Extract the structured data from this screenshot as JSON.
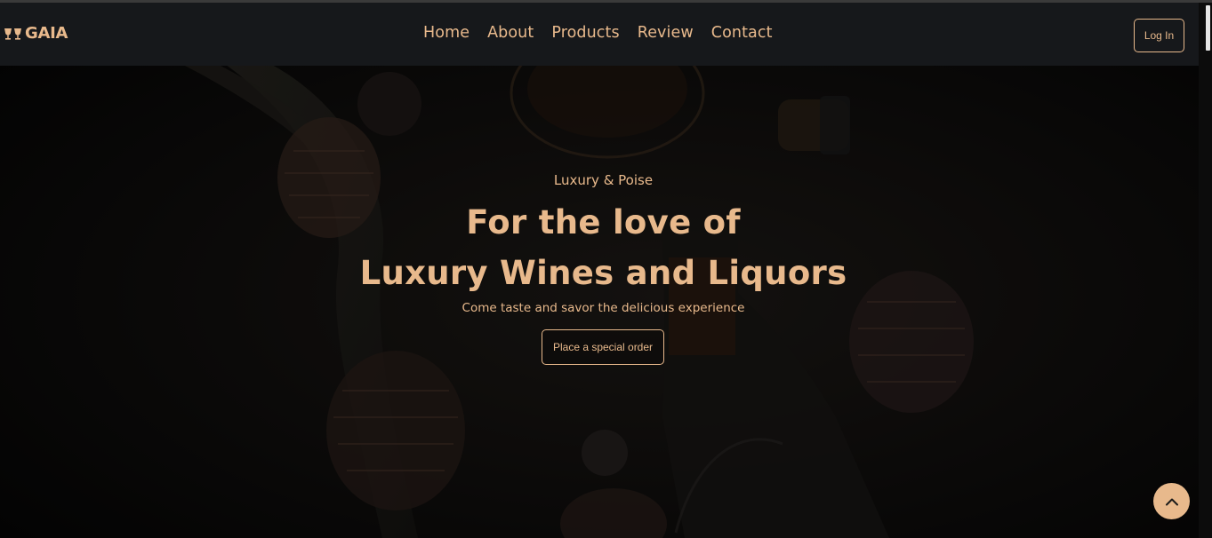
{
  "brand": {
    "name": "GAIA",
    "icon": "wine-glasses-icon"
  },
  "nav": {
    "items": [
      {
        "label": "Home"
      },
      {
        "label": "About"
      },
      {
        "label": "Products"
      },
      {
        "label": "Review"
      },
      {
        "label": "Contact"
      }
    ],
    "login_label": "Log In"
  },
  "hero": {
    "tagline": "Luxury & Poise",
    "title_line1": "For the love of",
    "title_line2": "Luxury Wines and Liquors",
    "subtitle": "Come taste and savor the delicious experience",
    "cta_label": "Place a special order"
  },
  "back_to_top": {
    "icon": "chevron-up-icon"
  },
  "colors": {
    "accent": "#e8b98c",
    "navbar_bg": "#16181b",
    "page_bg": "#0d0c0b"
  }
}
